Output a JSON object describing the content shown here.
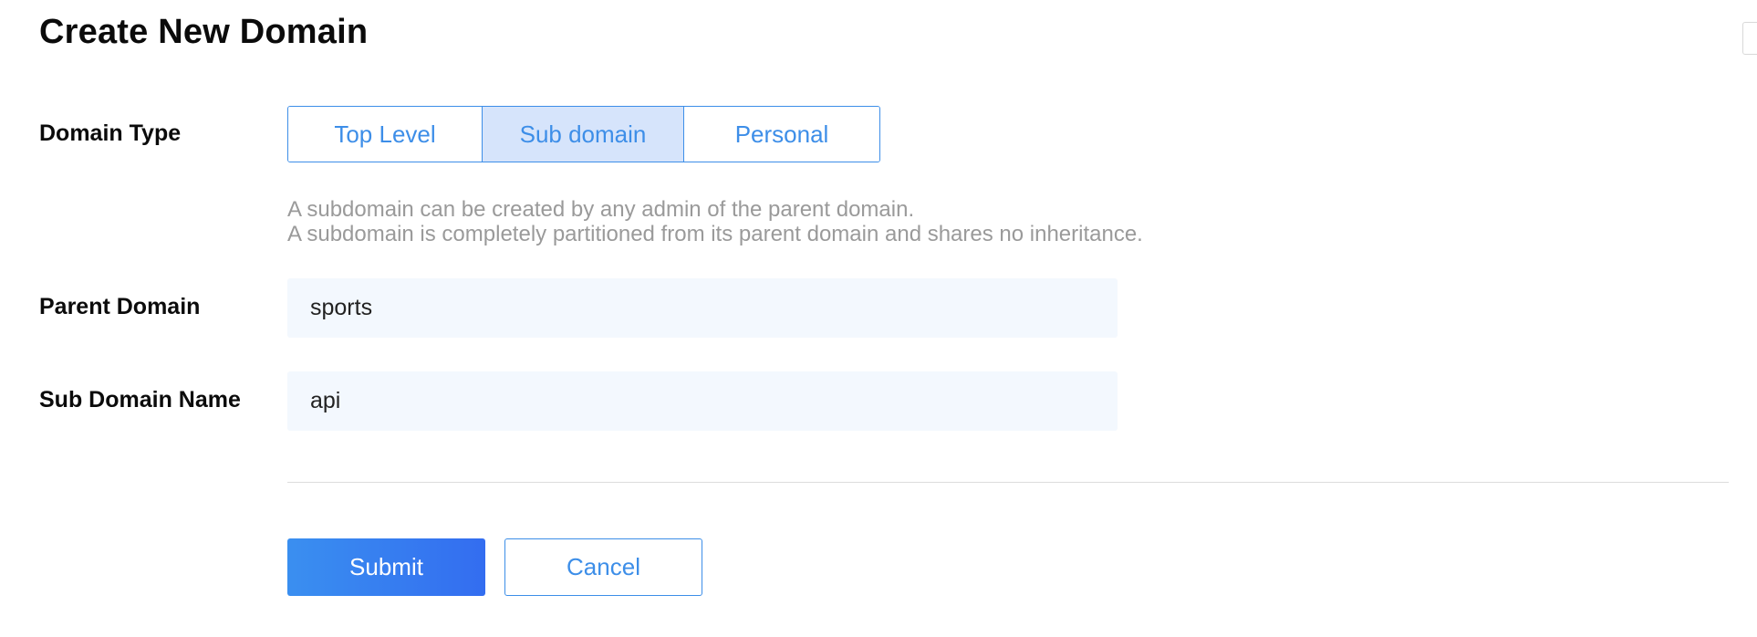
{
  "page": {
    "title": "Create New Domain"
  },
  "form": {
    "domain_type": {
      "label": "Domain Type",
      "options": [
        "Top Level",
        "Sub domain",
        "Personal"
      ],
      "selected": "Sub domain",
      "help_lines": [
        "A subdomain can be created by any admin of the parent domain.",
        "A subdomain is completely partitioned from its parent domain and shares no inheritance."
      ]
    },
    "parent_domain": {
      "label": "Parent Domain",
      "value": "sports"
    },
    "sub_domain_name": {
      "label": "Sub Domain Name",
      "value": "api"
    }
  },
  "actions": {
    "submit_label": "Submit",
    "cancel_label": "Cancel"
  },
  "colors": {
    "accent": "#3d8ee8",
    "selected_bg": "#d6e4fb",
    "input_bg": "#f3f8fe",
    "help_text": "#9a9a9a",
    "submit_gradient_start": "#3a8ff0",
    "submit_gradient_end": "#336df0"
  }
}
